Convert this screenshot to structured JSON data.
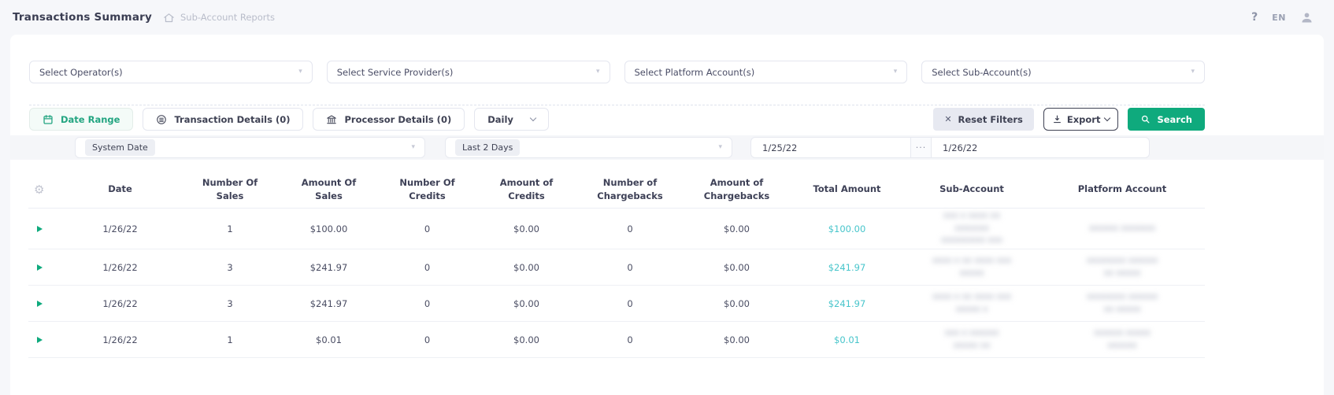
{
  "header": {
    "title": "Transactions Summary",
    "breadcrumb": "Sub-Account Reports",
    "help_glyph": "?",
    "language": "EN"
  },
  "filters": {
    "operators_placeholder": "Select Operator(s)",
    "service_providers_placeholder": "Select Service Provider(s)",
    "platform_accounts_placeholder": "Select Platform Account(s)",
    "sub_accounts_placeholder": "Select Sub-Account(s)",
    "caret_glyph": "▾"
  },
  "toolbar": {
    "tab_date_range": "Date Range",
    "tab_transaction_details": "Transaction Details (0)",
    "tab_processor_details": "Processor Details (0)",
    "frequency_select": "Daily",
    "reset_label": "Reset Filters",
    "reset_glyph": "✕",
    "export_label": "Export",
    "search_label": "Search"
  },
  "date_filter": {
    "type_chip": "System Date",
    "preset_chip": "Last 2 Days",
    "start_date": "1/25/22",
    "separator": "···",
    "end_date": "1/26/22"
  },
  "table": {
    "gear_glyph": "⚙",
    "headers": {
      "date": "Date",
      "number_of_sales": "Number Of\nSales",
      "amount_of_sales": "Amount Of\nSales",
      "number_of_credits": "Number Of\nCredits",
      "amount_of_credits": "Amount of\nCredits",
      "number_of_chargebacks": "Number of\nChargebacks",
      "amount_of_chargebacks": "Amount of\nChargebacks",
      "total_amount": "Total Amount",
      "sub_account": "Sub-Account",
      "platform_account": "Platform Account"
    },
    "rows": [
      {
        "date": "1/26/22",
        "number_of_sales": "1",
        "amount_of_sales": "$100.00",
        "number_of_credits": "0",
        "amount_of_credits": "$0.00",
        "number_of_chargebacks": "0",
        "amount_of_chargebacks": "$0.00",
        "total_amount": "$100.00",
        "sub_account_redacted": [
          "xxx x xxxx xx",
          "xxxxxxx",
          "xxxxxxxxx xxx"
        ],
        "platform_account_redacted": [
          "xxxxxx xxxxxxx"
        ]
      },
      {
        "date": "1/26/22",
        "number_of_sales": "3",
        "amount_of_sales": "$241.97",
        "number_of_credits": "0",
        "amount_of_credits": "$0.00",
        "number_of_chargebacks": "0",
        "amount_of_chargebacks": "$0.00",
        "total_amount": "$241.97",
        "sub_account_redacted": [
          "xxxx x xx xxxx xxx",
          "xxxxx"
        ],
        "platform_account_redacted": [
          "xxxxxxxx xxxxxx",
          "xx xxxxx"
        ]
      },
      {
        "date": "1/26/22",
        "number_of_sales": "3",
        "amount_of_sales": "$241.97",
        "number_of_credits": "0",
        "amount_of_credits": "$0.00",
        "number_of_chargebacks": "0",
        "amount_of_chargebacks": "$0.00",
        "total_amount": "$241.97",
        "sub_account_redacted": [
          "xxxx x xx xxxx xxx",
          "xxxxx x"
        ],
        "platform_account_redacted": [
          "xxxxxxxx xxxxxx",
          "xx xxxxx"
        ]
      },
      {
        "date": "1/26/22",
        "number_of_sales": "1",
        "amount_of_sales": "$0.01",
        "number_of_credits": "0",
        "amount_of_credits": "$0.00",
        "number_of_chargebacks": "0",
        "amount_of_chargebacks": "$0.00",
        "total_amount": "$0.01",
        "sub_account_redacted": [
          "xxx x xxxxxx",
          "xxxxx xx"
        ],
        "platform_account_redacted": [
          "xxxxxx xxxxx",
          "xxxxxx"
        ]
      }
    ]
  },
  "colors": {
    "accent-green": "#0faa7d",
    "link-teal": "#47c5cb",
    "text-dark": "#3f4254",
    "text-muted": "#b9bdca",
    "band-bg": "#f5f6f9"
  }
}
